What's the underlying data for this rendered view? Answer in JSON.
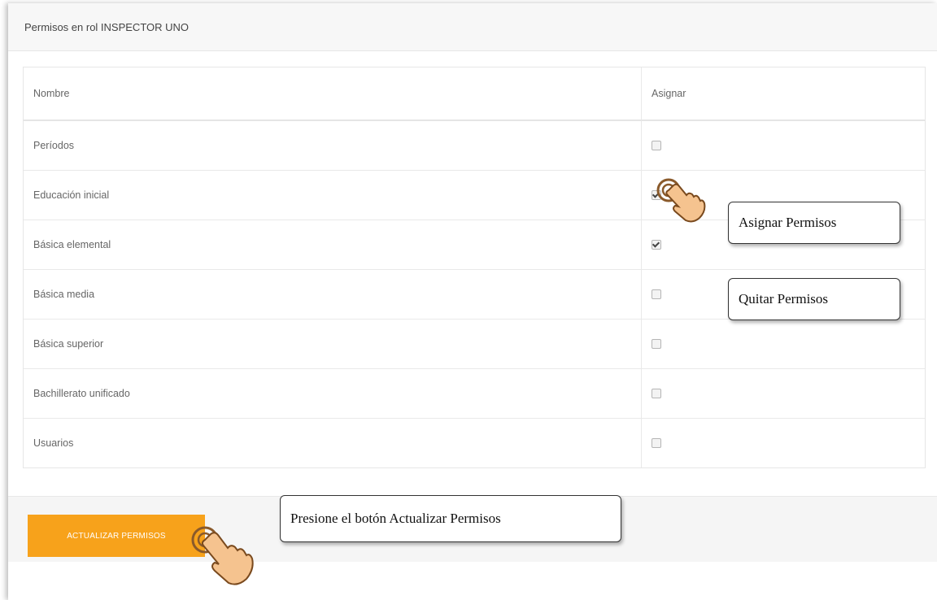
{
  "panel": {
    "title": "Permisos en rol INSPECTOR UNO"
  },
  "table": {
    "headers": {
      "name": "Nombre",
      "assign": "Asignar"
    },
    "rows": [
      {
        "name": "Períodos",
        "checked": false
      },
      {
        "name": "Educación inicial",
        "checked": true
      },
      {
        "name": "Básica elemental",
        "checked": true
      },
      {
        "name": "Básica media",
        "checked": false
      },
      {
        "name": "Básica superior",
        "checked": false
      },
      {
        "name": "Bachillerato unificado",
        "checked": false
      },
      {
        "name": "Usuarios",
        "checked": false
      }
    ]
  },
  "footer": {
    "update_label": "ACTUALIZAR PERMISOS"
  },
  "callouts": {
    "assign": "Asignar Permisos",
    "remove": "Quitar Permisos",
    "press": "Presione el botón Actualizar Permisos"
  },
  "colors": {
    "accent": "#f7a21b",
    "hand": "#f5c38f"
  },
  "icons": {
    "pointer": "hand-pointer-icon",
    "checkbox": "checkbox-icon"
  }
}
